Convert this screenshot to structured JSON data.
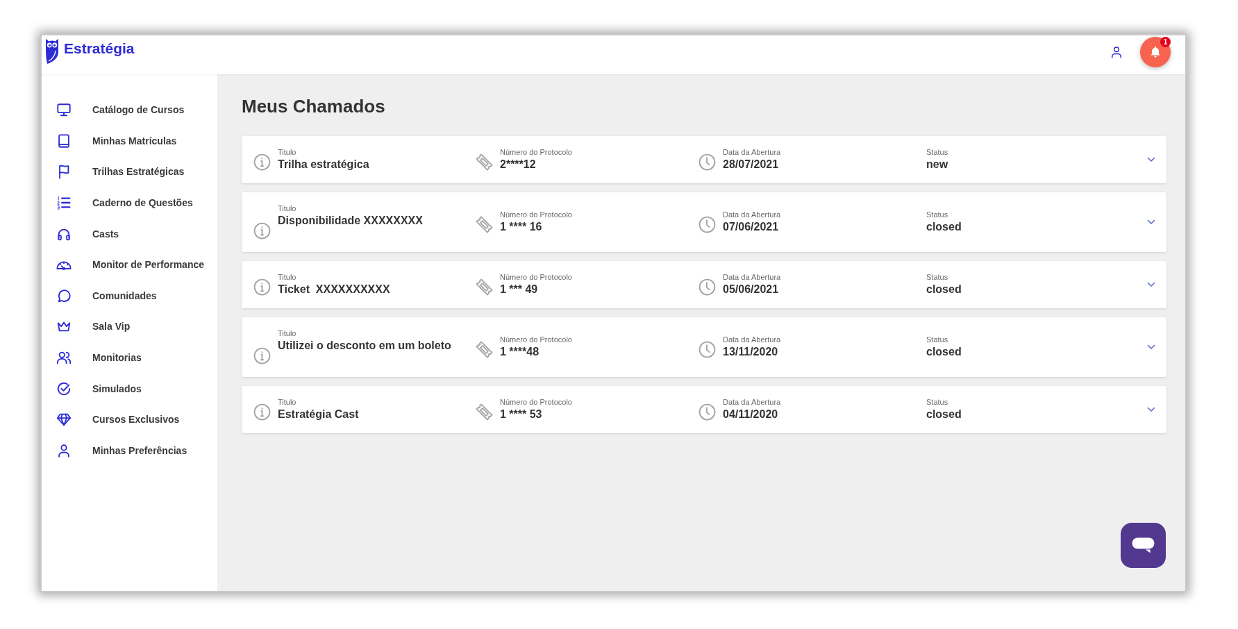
{
  "header": {
    "logo": "Estratégia",
    "notification_badge": "1"
  },
  "sidebar": {
    "items": [
      {
        "kind": "monitor",
        "label": "Catálogo de Cursos"
      },
      {
        "kind": "book",
        "label": "Minhas Matrículas"
      },
      {
        "kind": "flag",
        "label": "Trilhas Estratégicas"
      },
      {
        "kind": "list",
        "label": "Caderno de Questões"
      },
      {
        "kind": "headphones",
        "label": "Casts"
      },
      {
        "kind": "gauge",
        "label": "Monitor de Performance"
      },
      {
        "kind": "chat",
        "label": "Comunidades"
      },
      {
        "kind": "crown",
        "label": "Sala Vip"
      },
      {
        "kind": "people",
        "label": "Monitorias"
      },
      {
        "kind": "check",
        "label": "Simulados"
      },
      {
        "kind": "diamond",
        "label": "Cursos Exclusivos"
      },
      {
        "kind": "user",
        "label": "Minhas Preferências"
      }
    ]
  },
  "page": {
    "title": "Meus Chamados"
  },
  "tickets": [
    {
      "kind": "compact",
      "title_label": "Titulo",
      "title": "Trilha estratégica",
      "protocol_label": "Número do Protocolo",
      "protocol": "2****12",
      "date_label": "Data da Abertura",
      "date": "28/07/2021",
      "status_label": "Status",
      "status": "new"
    },
    {
      "kind": "tall",
      "title_label": "Titulo",
      "title": "Disponibilidade XXXXXXXX",
      "protocol_label": "Número do Protocolo",
      "protocol": "1 **** 16",
      "date_label": "Data da Abertura",
      "date": "07/06/2021",
      "status_label": "Status",
      "status": "closed"
    },
    {
      "kind": "compact",
      "title_label": "Titulo",
      "title": "Ticket  XXXXXXXXXX",
      "protocol_label": "Número do Protocolo",
      "protocol": "1 *** 49",
      "date_label": "Data da Abertura",
      "date": "05/06/2021",
      "status_label": "Status",
      "status": "closed"
    },
    {
      "kind": "tall",
      "title_label": "Titulo",
      "title": "Utilizei o desconto em um boleto",
      "protocol_label": "Número do Protocolo",
      "protocol": "1 ****48",
      "date_label": "Data da Abertura",
      "date": "13/11/2020",
      "status_label": "Status",
      "status": "closed"
    },
    {
      "kind": "compact",
      "title_label": "Titulo",
      "title": "Estratégia Cast",
      "protocol_label": "Número do Protocolo",
      "protocol": "1 **** 53",
      "date_label": "Data da Abertura",
      "date": "04/11/2020",
      "status_label": "Status",
      "status": "closed"
    }
  ]
}
